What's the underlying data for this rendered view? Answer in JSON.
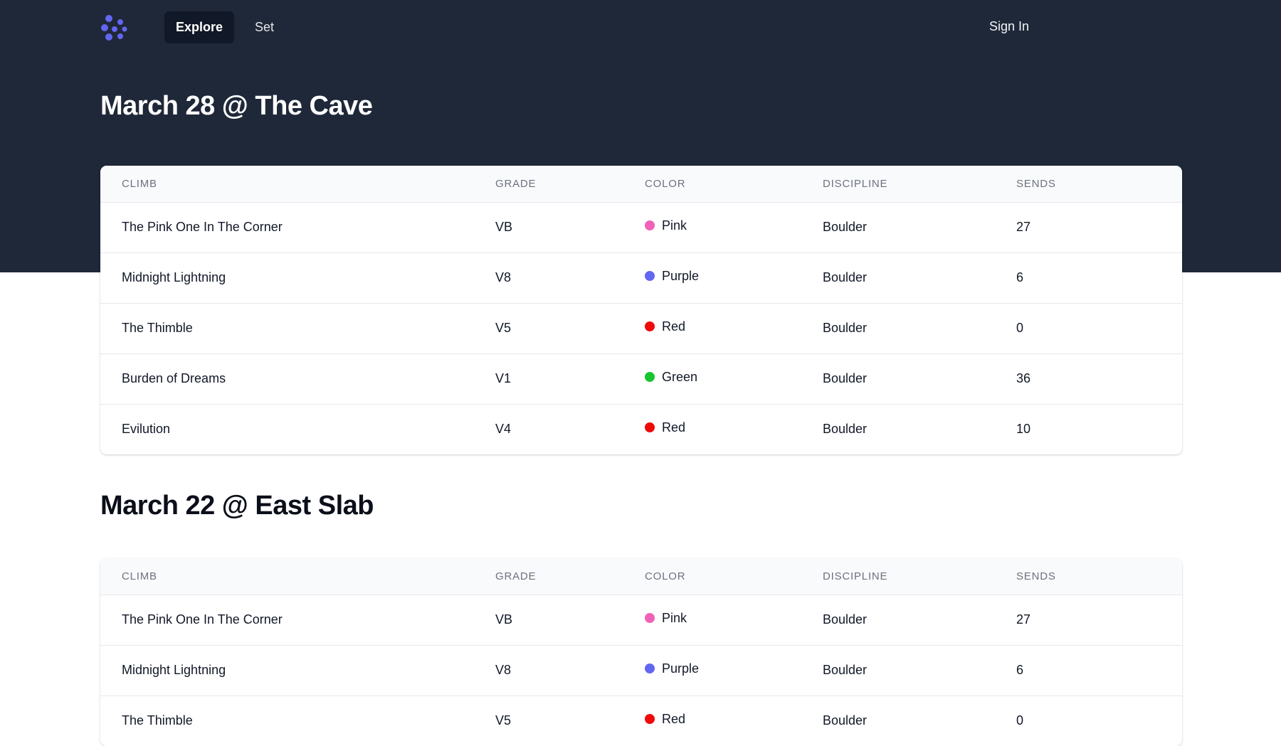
{
  "nav": {
    "logo": "app-logo",
    "links": [
      {
        "label": "Explore",
        "active": true
      },
      {
        "label": "Set",
        "active": false
      }
    ],
    "sign_in": "Sign In"
  },
  "colors": {
    "header_bg": "#1f2838",
    "Pink": "#f062b8",
    "Purple": "#6366f1",
    "Red": "#ef0a0a",
    "Green": "#16c530"
  },
  "columns": [
    "CLIMB",
    "GRADE",
    "COLOR",
    "DISCIPLINE",
    "SENDS"
  ],
  "sections": [
    {
      "title": "March 28 @ The Cave",
      "rows": [
        {
          "climb": "The Pink One In The Corner",
          "grade": "VB",
          "color": "Pink",
          "discipline": "Boulder",
          "sends": "27"
        },
        {
          "climb": "Midnight Lightning",
          "grade": "V8",
          "color": "Purple",
          "discipline": "Boulder",
          "sends": "6"
        },
        {
          "climb": "The Thimble",
          "grade": "V5",
          "color": "Red",
          "discipline": "Boulder",
          "sends": "0"
        },
        {
          "climb": "Burden of Dreams",
          "grade": "V1",
          "color": "Green",
          "discipline": "Boulder",
          "sends": "36"
        },
        {
          "climb": "Evilution",
          "grade": "V4",
          "color": "Red",
          "discipline": "Boulder",
          "sends": "10"
        }
      ]
    },
    {
      "title": "March 22 @ East Slab",
      "rows": [
        {
          "climb": "The Pink One In The Corner",
          "grade": "VB",
          "color": "Pink",
          "discipline": "Boulder",
          "sends": "27"
        },
        {
          "climb": "Midnight Lightning",
          "grade": "V8",
          "color": "Purple",
          "discipline": "Boulder",
          "sends": "6"
        },
        {
          "climb": "The Thimble",
          "grade": "V5",
          "color": "Red",
          "discipline": "Boulder",
          "sends": "0"
        }
      ]
    }
  ]
}
